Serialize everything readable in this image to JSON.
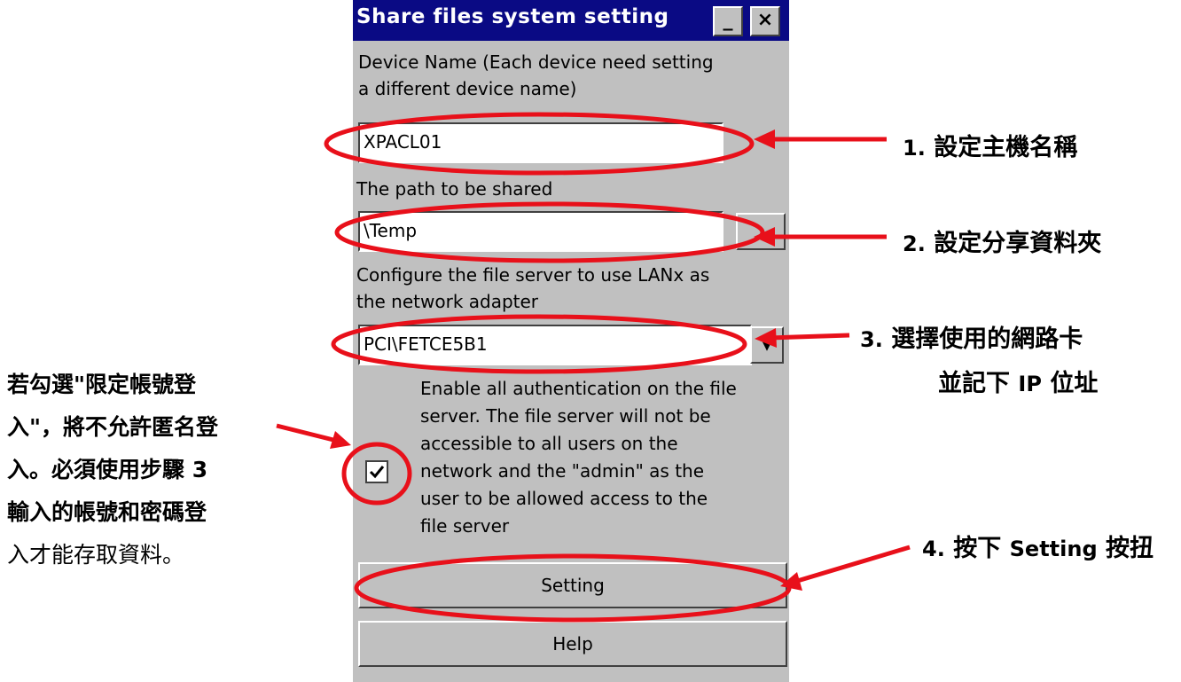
{
  "window": {
    "title": "Share files system setting",
    "minimize_glyph": "_",
    "close_glyph": "×"
  },
  "device_name": {
    "label_line1": "Device Name (Each device need setting",
    "label_line2": "a different device name)",
    "value": "XPACL01"
  },
  "shared_path": {
    "label": "The path to be shared",
    "value": "\\Temp",
    "browse_label": "..."
  },
  "adapter": {
    "label_line1": "Configure the file server to use LANx as",
    "label_line2": "the network adapter",
    "selected": "PCI\\FETCE5B1"
  },
  "auth": {
    "checked": true,
    "lines": [
      "Enable all authentication on the file",
      "server. The file server will not be",
      "accessible to all users on the",
      "network and the \"admin\" as the",
      "user to be allowed access to the",
      "file server"
    ]
  },
  "buttons": {
    "setting": "Setting",
    "help": "Help"
  },
  "annotations": {
    "step1": {
      "num": "1.",
      "text": "設定主機名稱"
    },
    "step2": {
      "num": "2.",
      "text": "設定分享資料夾"
    },
    "step3": {
      "num": "3.",
      "line1": "選擇使用的網路卡",
      "line2_pre": "並記下 ",
      "line2_bold": "IP",
      "line2_post": " 位址"
    },
    "step4": {
      "num": "4.",
      "pre": "按下 ",
      "bold": "Setting",
      "post": " 按扭"
    },
    "left_note": [
      "若勾選\"限定帳號登",
      "入\"，將不允許匿名登",
      "入。必須使用步驟 3",
      "輸入的帳號和密碼登",
      "入才能存取資料。"
    ]
  },
  "colors": {
    "titlebar": "#0a0a84",
    "window_bg": "#c0c0c0",
    "annotation_red": "#e8101a"
  }
}
